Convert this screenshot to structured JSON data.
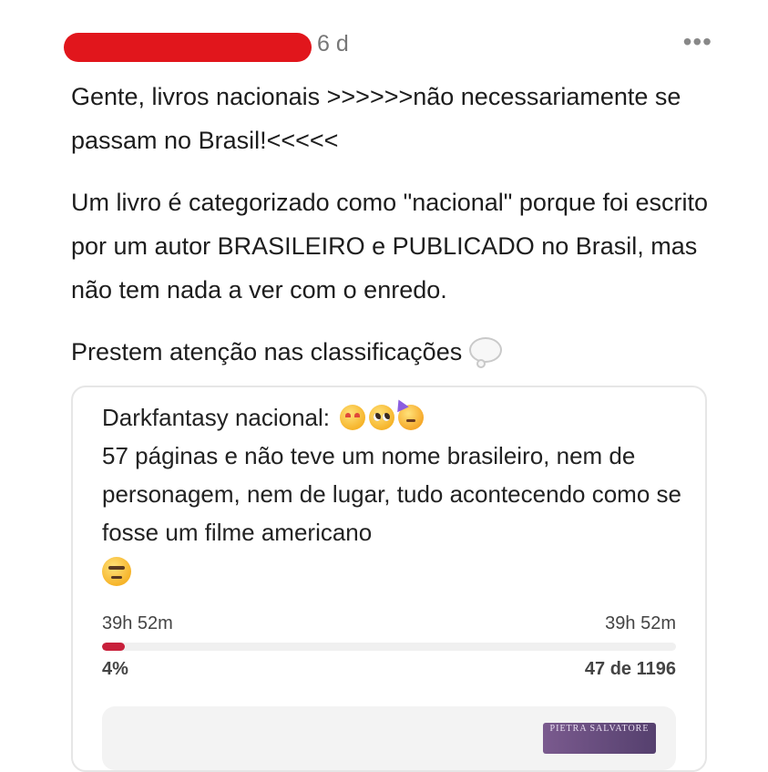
{
  "post": {
    "timestamp": "6 d",
    "menu_glyph": "•••",
    "paragraph1": "Gente, livros nacionais >>>>>>não necessariamente se passam no Brasil!<<<<<",
    "paragraph2": "Um livro é categorizado como \"nacional\" porque foi escrito por um autor BRASILEIRO e PUBLICADO no Brasil, mas não tem nada a ver com o enredo.",
    "paragraph3": "Prestem atenção nas classificações",
    "paragraph3_icon": "thought-bubble-icon"
  },
  "review": {
    "title": "Darkfantasy nacional:",
    "title_emojis": [
      "smiling-hearts-emoji-icon",
      "pleading-face-emoji-icon",
      "partying-face-emoji-icon"
    ],
    "body": "57 páginas e não teve um nome brasileiro, nem de personagem, nem de lugar, tudo acontecendo como se fosse um filme americano",
    "body_emoji": "face-raised-eyebrow-emoji-icon",
    "progress": {
      "left_time": "39h 52m",
      "right_time": "39h 52m",
      "percent_label": "4%",
      "percent_value": 0.04,
      "pages_label": "47 de 1196",
      "fill_color": "#c8203b"
    },
    "book_thumb_text": "PIETRA SALVATORE"
  },
  "colors": {
    "redaction": "#e1161c",
    "accent": "#c8203b"
  }
}
